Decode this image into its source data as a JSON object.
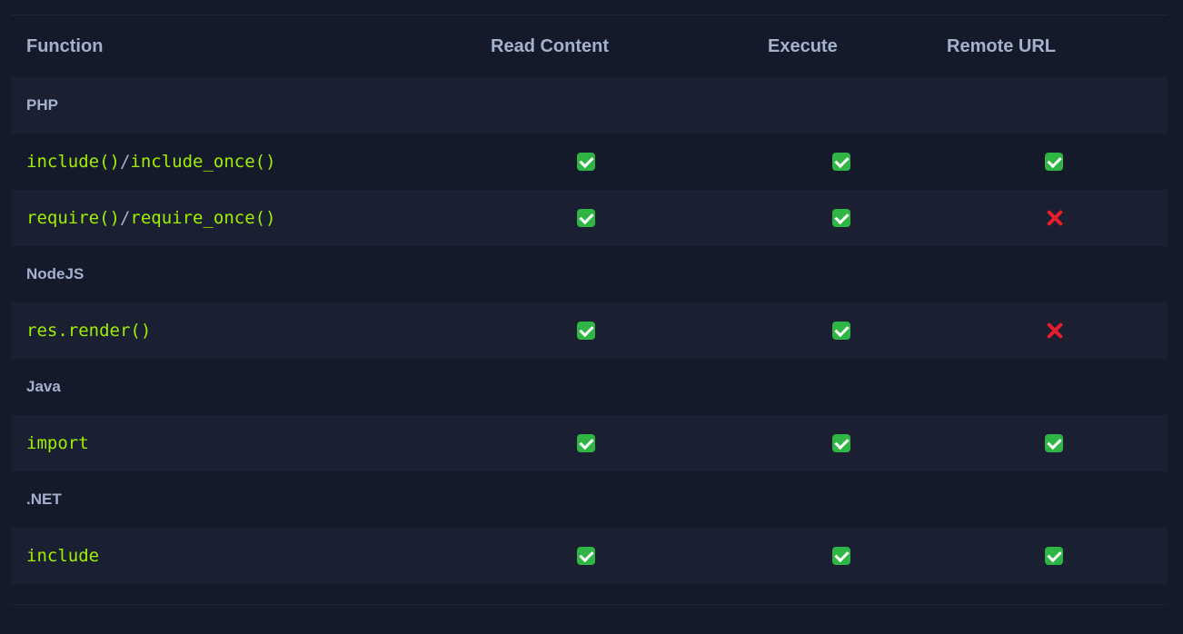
{
  "table": {
    "headers": [
      "Function",
      "Read Content",
      "Execute",
      "Remote URL"
    ],
    "rows": [
      {
        "kind": "group",
        "label": "PHP"
      },
      {
        "kind": "func",
        "parts": [
          "include()",
          "/",
          "include_once()"
        ],
        "read": "check",
        "execute": "check",
        "remote": "check"
      },
      {
        "kind": "func",
        "parts": [
          "require()",
          "/",
          "require_once()"
        ],
        "read": "check",
        "execute": "check",
        "remote": "cross"
      },
      {
        "kind": "group",
        "label": "NodeJS"
      },
      {
        "kind": "func",
        "parts": [
          "res.render()"
        ],
        "read": "check",
        "execute": "check",
        "remote": "cross"
      },
      {
        "kind": "group",
        "label": "Java"
      },
      {
        "kind": "func",
        "parts": [
          "import"
        ],
        "read": "check",
        "execute": "check",
        "remote": "check"
      },
      {
        "kind": "group",
        "label": ".NET"
      },
      {
        "kind": "func",
        "parts": [
          "include"
        ],
        "read": "check",
        "execute": "check",
        "remote": "check"
      }
    ]
  },
  "icons": {
    "check": "check-mark-icon",
    "cross": "cross-mark-icon"
  },
  "colors": {
    "background": "#141a2a",
    "row_shade": "#1a2032",
    "header_text": "#a4b1cd",
    "code_text": "#9fef00",
    "check": "#2fb544",
    "cross": "#e81d2c"
  }
}
